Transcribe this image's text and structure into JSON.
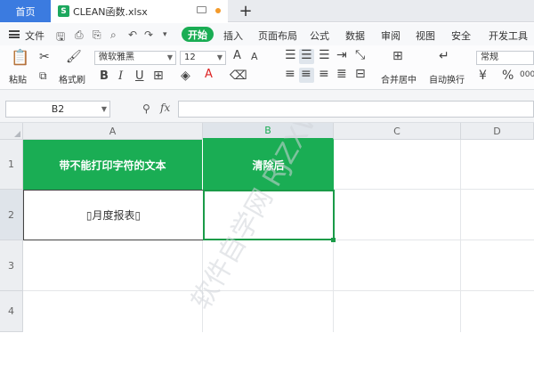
{
  "title_bar": {
    "home_tab": "首页",
    "doc_icon": "S",
    "doc_name": "CLEAN函数.xlsx",
    "add_tab": "+"
  },
  "menu": {
    "file": "文件",
    "start": "开始",
    "items": [
      "插入",
      "页面布局",
      "公式",
      "数据",
      "审阅",
      "视图",
      "安全",
      "开发工具"
    ]
  },
  "ribbon": {
    "paste": "粘贴",
    "format_painter": "格式刷",
    "font_name": "微软雅黑",
    "font_size": "12",
    "merge_center": "合并居中",
    "wrap_text": "自动换行",
    "number_format": "常规",
    "font_grow": "A",
    "font_shrink": "A",
    "bold": "B",
    "italic": "I",
    "underline": "U",
    "percent": "%",
    "thousands": "000"
  },
  "formula_bar": {
    "name_box": "B2",
    "fx": "fx",
    "value": ""
  },
  "sheet": {
    "columns": [
      "A",
      "B",
      "C",
      "D"
    ],
    "rows": [
      "1",
      "2",
      "3",
      "4"
    ],
    "A1": "带不能打印字符的文本",
    "B1": "清除后",
    "A2": "▯月度报表▯",
    "B2": ""
  },
  "watermark": "软件自学网 RJZXW.COM",
  "colors": {
    "accent_green": "#1aad54",
    "home_tab_blue": "#3b7be0"
  }
}
